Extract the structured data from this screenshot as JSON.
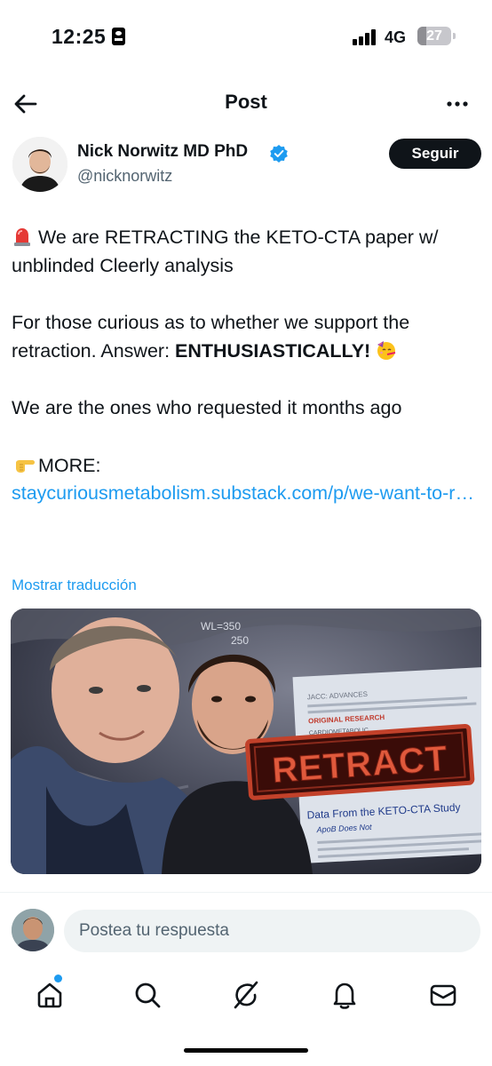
{
  "status_bar": {
    "time": "12:25",
    "network": "4G",
    "battery": "27",
    "battery_level": 0.27
  },
  "header": {
    "title": "Post"
  },
  "author": {
    "name": "Nick Norwitz MD PhD",
    "handle": "@nicknorwitz",
    "follow_label": "Seguir"
  },
  "post": {
    "p1": "We are RETRACTING the KETO-CTA paper w/ unblinded Cleerly analysis",
    "p2_pre": "For those curious as to whether we support the retraction. Answer: ",
    "p2_bold": "ENTHUSIASTICALLY!",
    "p3": "We are the ones who requested it months ago",
    "p4_label": "MORE:",
    "link": "staycuriousmetabolism.substack.com/p/we-want-to-r…"
  },
  "translate_label": "Mostrar traducción",
  "media": {
    "retract_label": "RETRACT",
    "wl_label": "WL=350",
    "ww_label": "250",
    "paper_header": "JACC: ADVANCES",
    "paper_section": "ORIGINAL RESEARCH",
    "paper_subsection": "CARDIOMETABOLIC",
    "paper_title": "Data From the KETO-CTA Study",
    "paper_line": "ApoB Does Not"
  },
  "reply": {
    "placeholder": "Postea tu respuesta"
  },
  "nav": {
    "items": [
      "home-icon",
      "search-icon",
      "grok-icon",
      "notifications-icon",
      "messages-icon"
    ]
  },
  "colors": {
    "accent": "#1d9bf0",
    "text": "#0f1419",
    "muted": "#536471",
    "follow_bg": "#0f1419",
    "retract_red": "#b8321f"
  }
}
